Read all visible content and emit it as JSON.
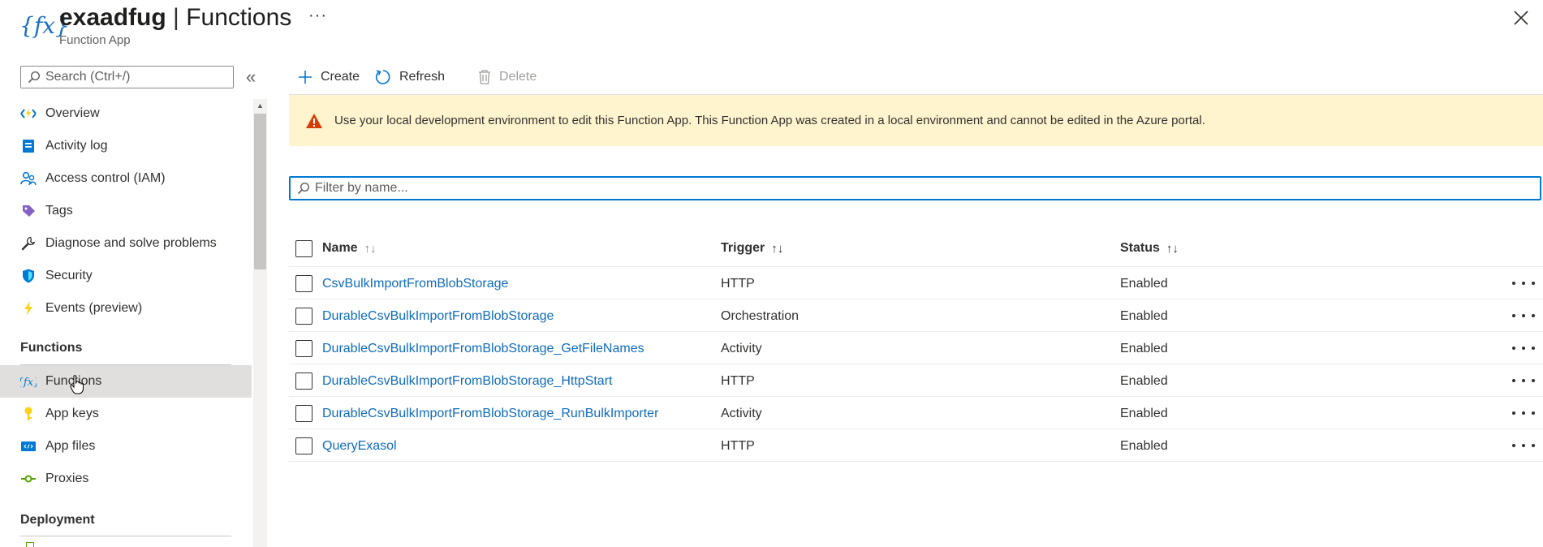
{
  "header": {
    "app_name": "exaadfug",
    "separator": " | ",
    "page": "Functions",
    "subtitle": "Function App",
    "more": "···",
    "app_icon_text": "{fx}",
    "close_icon": "close-icon"
  },
  "sidebar": {
    "search_placeholder": "Search (Ctrl+/)",
    "collapse_glyph": "«",
    "items": [
      {
        "label": "Overview",
        "icon": "function-lightning-icon"
      },
      {
        "label": "Activity log",
        "icon": "activity-log-icon"
      },
      {
        "label": "Access control (IAM)",
        "icon": "access-control-icon"
      },
      {
        "label": "Tags",
        "icon": "tag-icon"
      },
      {
        "label": "Diagnose and solve problems",
        "icon": "wrench-icon"
      },
      {
        "label": "Security",
        "icon": "shield-icon"
      },
      {
        "label": "Events (preview)",
        "icon": "lightning-icon"
      }
    ],
    "functions_section": "Functions",
    "function_items": [
      {
        "label": "Functions",
        "icon": "function-fx-icon",
        "selected": true
      },
      {
        "label": "App keys",
        "icon": "key-icon"
      },
      {
        "label": "App files",
        "icon": "code-file-icon"
      },
      {
        "label": "Proxies",
        "icon": "proxy-icon"
      }
    ],
    "deployment_section": "Deployment"
  },
  "toolbar": {
    "create": "Create",
    "refresh": "Refresh",
    "delete": "Delete"
  },
  "banner": {
    "text": "Use your local development environment to edit this Function App. This Function App was created in a local environment and cannot be edited in the Azure portal.",
    "icon": "warning-icon"
  },
  "filter": {
    "placeholder": "Filter by name..."
  },
  "table": {
    "columns": [
      {
        "label": "Name",
        "sort": "↑↓"
      },
      {
        "label": "Trigger",
        "sort": "↑↓"
      },
      {
        "label": "Status",
        "sort": "↑↓"
      }
    ],
    "rows": [
      {
        "name": "CsvBulkImportFromBlobStorage",
        "trigger": "HTTP",
        "status": "Enabled"
      },
      {
        "name": "DurableCsvBulkImportFromBlobStorage",
        "trigger": "Orchestration",
        "status": "Enabled"
      },
      {
        "name": "DurableCsvBulkImportFromBlobStorage_GetFileNames",
        "trigger": "Activity",
        "status": "Enabled"
      },
      {
        "name": "DurableCsvBulkImportFromBlobStorage_HttpStart",
        "trigger": "HTTP",
        "status": "Enabled"
      },
      {
        "name": "DurableCsvBulkImportFromBlobStorage_RunBulkImporter",
        "trigger": "Activity",
        "status": "Enabled"
      },
      {
        "name": "QueryExasol",
        "trigger": "HTTP",
        "status": "Enabled"
      }
    ]
  },
  "colors": {
    "accent": "#0078d4",
    "link": "#0f6cbd",
    "banner_bg": "#fff4ce",
    "warning": "#d83b01",
    "selected_bg": "#e1dfdd"
  }
}
